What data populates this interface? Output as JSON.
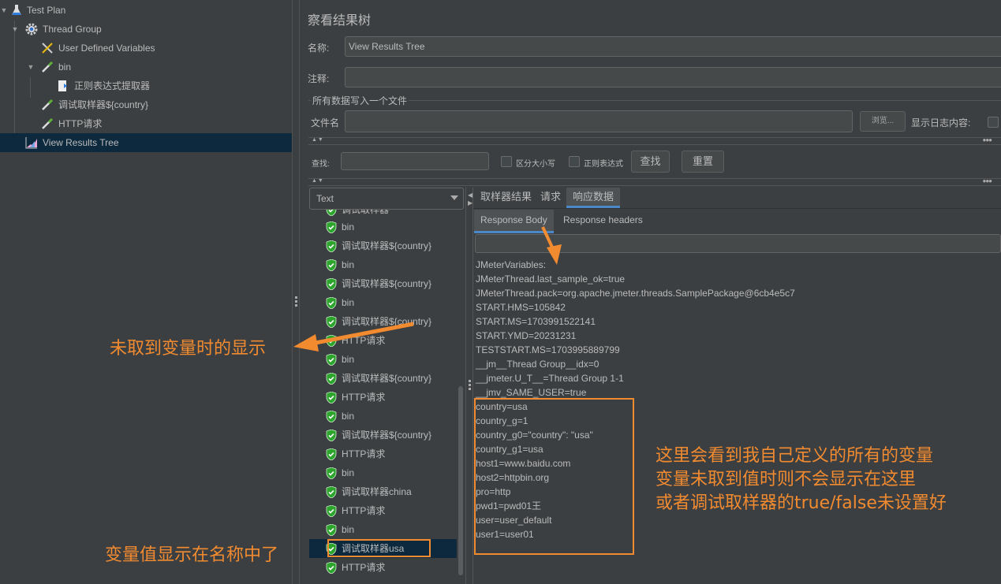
{
  "tree": {
    "items": [
      {
        "label": "Test Plan",
        "icon": "flask-icon",
        "expanded": true
      },
      {
        "label": "Thread Group",
        "icon": "gear-icon",
        "expanded": true
      },
      {
        "label": "User Defined Variables",
        "icon": "wrench-screwdriver-icon"
      },
      {
        "label": "bin",
        "icon": "pipette-icon",
        "expanded": true
      },
      {
        "label": "正则表达式提取器",
        "icon": "extractor-icon"
      },
      {
        "label": "调试取样器${country}",
        "icon": "pipette-icon"
      },
      {
        "label": "HTTP请求",
        "icon": "pipette-icon"
      },
      {
        "label": "View Results Tree",
        "icon": "chart-icon",
        "selected": true
      }
    ]
  },
  "panel": {
    "title": "察看结果树",
    "name_label": "名称:",
    "name_value": "View Results Tree",
    "comment_label": "注释:",
    "comment_value": "",
    "file_group_title": "所有数据写入一个文件",
    "filename_label": "文件名",
    "filename_value": "",
    "browse_button": "浏览...",
    "show_log_label": "显示日志内容:",
    "show_log_checked": false
  },
  "search": {
    "label": "查找:",
    "value": "",
    "case_sensitive_label": "区分大小写",
    "case_sensitive_checked": false,
    "regex_label": "正则表达式",
    "regex_checked": false,
    "find_button": "查找",
    "reset_button": "重置"
  },
  "renderer": {
    "selected": "Text"
  },
  "results": {
    "partial_top_label": "调试取样器",
    "items": [
      {
        "label": "bin",
        "status": "success"
      },
      {
        "label": "调试取样器${country}",
        "status": "success"
      },
      {
        "label": "bin",
        "status": "success"
      },
      {
        "label": "调试取样器${country}",
        "status": "success"
      },
      {
        "label": "bin",
        "status": "success"
      },
      {
        "label": "调试取样器${country}",
        "status": "success"
      },
      {
        "label": "HTTP请求",
        "status": "success"
      },
      {
        "label": "bin",
        "status": "success"
      },
      {
        "label": "调试取样器${country}",
        "status": "success"
      },
      {
        "label": "HTTP请求",
        "status": "success"
      },
      {
        "label": "bin",
        "status": "success"
      },
      {
        "label": "调试取样器${country}",
        "status": "success"
      },
      {
        "label": "HTTP请求",
        "status": "success"
      },
      {
        "label": "bin",
        "status": "success"
      },
      {
        "label": "调试取样器china",
        "status": "success"
      },
      {
        "label": "HTTP请求",
        "status": "success"
      },
      {
        "label": "bin",
        "status": "success"
      },
      {
        "label": "调试取样器usa",
        "status": "success",
        "selected": true
      },
      {
        "label": "HTTP请求",
        "status": "success"
      }
    ]
  },
  "tabs": [
    {
      "label": "取样器结果"
    },
    {
      "label": "请求"
    },
    {
      "label": "响应数据",
      "active": true
    }
  ],
  "subtabs": [
    {
      "label": "Response Body",
      "active": true
    },
    {
      "label": "Response headers"
    }
  ],
  "response_body": {
    "lines": [
      "JMeterVariables:",
      "JMeterThread.last_sample_ok=true",
      "JMeterThread.pack=org.apache.jmeter.threads.SamplePackage@6cb4e5c7",
      "START.HMS=105842",
      "START.MS=1703991522141",
      "START.YMD=20231231",
      "TESTSTART.MS=1703995889799",
      "__jm__Thread Group__idx=0",
      "__jmeter.U_T__=Thread Group 1-1",
      "__jmv_SAME_USER=true",
      "country=usa",
      "country_g=1",
      "country_g0=\"country\": \"usa\"",
      "country_g1=usa",
      "host1=www.baidu.com",
      "host2=httpbin.org",
      "pro=http",
      "pwd1=pwd01王",
      "user=user_default",
      "user1=user01"
    ]
  },
  "annotations": {
    "color": "#f28b30",
    "unresolved_note": "未取到变量时的显示",
    "value_in_name_note": "变量值显示在名称中了",
    "variables_note": [
      "这里会看到我自己定义的所有的变量",
      "变量未取到值时则不会显示在这里",
      "或者调试取样器的true/false未设置好"
    ]
  }
}
